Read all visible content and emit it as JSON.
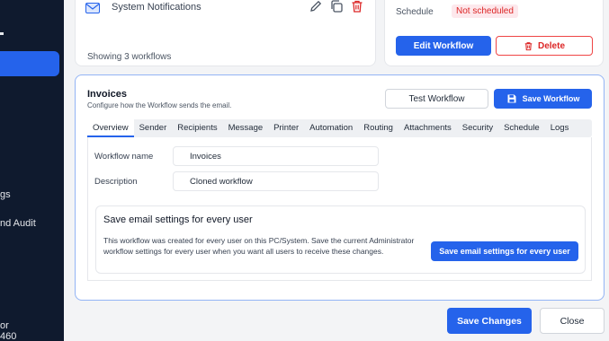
{
  "sidebar": {
    "items": [
      {
        "label": "gs"
      },
      {
        "label": "nd Audit"
      },
      {
        "label": "or"
      },
      {
        "label": "460"
      }
    ]
  },
  "workflow_list": {
    "item_name": "System Notifications",
    "showing": "Showing 3 workflows"
  },
  "workflow_detail": {
    "schedule_label": "Schedule",
    "schedule_status": "Not scheduled",
    "edit_label": "Edit Workflow",
    "delete_label": "Delete"
  },
  "panel": {
    "title": "Invoices",
    "subtitle": "Configure how the Workflow sends the email.",
    "test_label": "Test Workflow",
    "save_label": "Save Workflow",
    "tabs": [
      {
        "label": "Overview"
      },
      {
        "label": "Sender"
      },
      {
        "label": "Recipients"
      },
      {
        "label": "Message"
      },
      {
        "label": "Printer"
      },
      {
        "label": "Automation"
      },
      {
        "label": "Routing"
      },
      {
        "label": "Attachments"
      },
      {
        "label": "Security"
      },
      {
        "label": "Schedule"
      },
      {
        "label": "Logs"
      }
    ],
    "active_tab": "Overview",
    "fields": {
      "name_label": "Workflow name",
      "name_value": "Invoices",
      "desc_label": "Description",
      "desc_value": "Cloned workflow"
    },
    "every_user": {
      "title": "Save email settings for every user",
      "description": "This workflow was created for every user on this PC/System. Save the current Administrator workflow settings for every user when you want all users to receive these changes.",
      "button_label": "Save email settings for every user"
    }
  },
  "footer": {
    "save_label": "Save Changes",
    "close_label": "Close"
  },
  "colors": {
    "accent": "#2563eb",
    "danger": "#dc2626",
    "sidebar_bg": "#0f1a2e"
  }
}
